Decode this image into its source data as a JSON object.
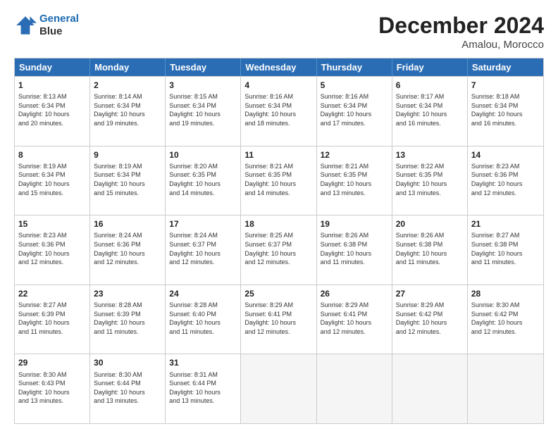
{
  "header": {
    "logo_line1": "General",
    "logo_line2": "Blue",
    "title": "December 2024",
    "subtitle": "Amalou, Morocco"
  },
  "days": [
    "Sunday",
    "Monday",
    "Tuesday",
    "Wednesday",
    "Thursday",
    "Friday",
    "Saturday"
  ],
  "weeks": [
    [
      {
        "day": "1",
        "info": "Sunrise: 8:13 AM\nSunset: 6:34 PM\nDaylight: 10 hours\nand 20 minutes."
      },
      {
        "day": "2",
        "info": "Sunrise: 8:14 AM\nSunset: 6:34 PM\nDaylight: 10 hours\nand 19 minutes."
      },
      {
        "day": "3",
        "info": "Sunrise: 8:15 AM\nSunset: 6:34 PM\nDaylight: 10 hours\nand 19 minutes."
      },
      {
        "day": "4",
        "info": "Sunrise: 8:16 AM\nSunset: 6:34 PM\nDaylight: 10 hours\nand 18 minutes."
      },
      {
        "day": "5",
        "info": "Sunrise: 8:16 AM\nSunset: 6:34 PM\nDaylight: 10 hours\nand 17 minutes."
      },
      {
        "day": "6",
        "info": "Sunrise: 8:17 AM\nSunset: 6:34 PM\nDaylight: 10 hours\nand 16 minutes."
      },
      {
        "day": "7",
        "info": "Sunrise: 8:18 AM\nSunset: 6:34 PM\nDaylight: 10 hours\nand 16 minutes."
      }
    ],
    [
      {
        "day": "8",
        "info": "Sunrise: 8:19 AM\nSunset: 6:34 PM\nDaylight: 10 hours\nand 15 minutes."
      },
      {
        "day": "9",
        "info": "Sunrise: 8:19 AM\nSunset: 6:34 PM\nDaylight: 10 hours\nand 15 minutes."
      },
      {
        "day": "10",
        "info": "Sunrise: 8:20 AM\nSunset: 6:35 PM\nDaylight: 10 hours\nand 14 minutes."
      },
      {
        "day": "11",
        "info": "Sunrise: 8:21 AM\nSunset: 6:35 PM\nDaylight: 10 hours\nand 14 minutes."
      },
      {
        "day": "12",
        "info": "Sunrise: 8:21 AM\nSunset: 6:35 PM\nDaylight: 10 hours\nand 13 minutes."
      },
      {
        "day": "13",
        "info": "Sunrise: 8:22 AM\nSunset: 6:35 PM\nDaylight: 10 hours\nand 13 minutes."
      },
      {
        "day": "14",
        "info": "Sunrise: 8:23 AM\nSunset: 6:36 PM\nDaylight: 10 hours\nand 12 minutes."
      }
    ],
    [
      {
        "day": "15",
        "info": "Sunrise: 8:23 AM\nSunset: 6:36 PM\nDaylight: 10 hours\nand 12 minutes."
      },
      {
        "day": "16",
        "info": "Sunrise: 8:24 AM\nSunset: 6:36 PM\nDaylight: 10 hours\nand 12 minutes."
      },
      {
        "day": "17",
        "info": "Sunrise: 8:24 AM\nSunset: 6:37 PM\nDaylight: 10 hours\nand 12 minutes."
      },
      {
        "day": "18",
        "info": "Sunrise: 8:25 AM\nSunset: 6:37 PM\nDaylight: 10 hours\nand 12 minutes."
      },
      {
        "day": "19",
        "info": "Sunrise: 8:26 AM\nSunset: 6:38 PM\nDaylight: 10 hours\nand 11 minutes."
      },
      {
        "day": "20",
        "info": "Sunrise: 8:26 AM\nSunset: 6:38 PM\nDaylight: 10 hours\nand 11 minutes."
      },
      {
        "day": "21",
        "info": "Sunrise: 8:27 AM\nSunset: 6:38 PM\nDaylight: 10 hours\nand 11 minutes."
      }
    ],
    [
      {
        "day": "22",
        "info": "Sunrise: 8:27 AM\nSunset: 6:39 PM\nDaylight: 10 hours\nand 11 minutes."
      },
      {
        "day": "23",
        "info": "Sunrise: 8:28 AM\nSunset: 6:39 PM\nDaylight: 10 hours\nand 11 minutes."
      },
      {
        "day": "24",
        "info": "Sunrise: 8:28 AM\nSunset: 6:40 PM\nDaylight: 10 hours\nand 11 minutes."
      },
      {
        "day": "25",
        "info": "Sunrise: 8:29 AM\nSunset: 6:41 PM\nDaylight: 10 hours\nand 12 minutes."
      },
      {
        "day": "26",
        "info": "Sunrise: 8:29 AM\nSunset: 6:41 PM\nDaylight: 10 hours\nand 12 minutes."
      },
      {
        "day": "27",
        "info": "Sunrise: 8:29 AM\nSunset: 6:42 PM\nDaylight: 10 hours\nand 12 minutes."
      },
      {
        "day": "28",
        "info": "Sunrise: 8:30 AM\nSunset: 6:42 PM\nDaylight: 10 hours\nand 12 minutes."
      }
    ],
    [
      {
        "day": "29",
        "info": "Sunrise: 8:30 AM\nSunset: 6:43 PM\nDaylight: 10 hours\nand 13 minutes."
      },
      {
        "day": "30",
        "info": "Sunrise: 8:30 AM\nSunset: 6:44 PM\nDaylight: 10 hours\nand 13 minutes."
      },
      {
        "day": "31",
        "info": "Sunrise: 8:31 AM\nSunset: 6:44 PM\nDaylight: 10 hours\nand 13 minutes."
      },
      {
        "day": "",
        "info": ""
      },
      {
        "day": "",
        "info": ""
      },
      {
        "day": "",
        "info": ""
      },
      {
        "day": "",
        "info": ""
      }
    ]
  ]
}
